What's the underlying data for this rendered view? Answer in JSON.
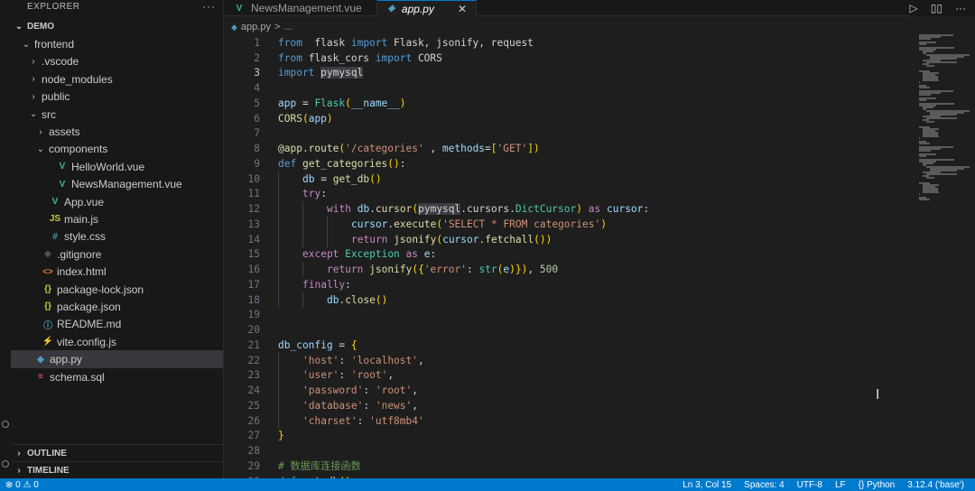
{
  "sidebar": {
    "title": "EXPLORER",
    "more": "···",
    "tree": [
      {
        "label": "DEMO",
        "depth": 0,
        "chevron": "open",
        "icon": "",
        "kind": "root"
      },
      {
        "label": "frontend",
        "depth": 1,
        "chevron": "open",
        "icon": "",
        "kind": "folder"
      },
      {
        "label": ".vscode",
        "depth": 2,
        "chevron": "closed",
        "icon": "",
        "kind": "folder"
      },
      {
        "label": "node_modules",
        "depth": 2,
        "chevron": "closed",
        "icon": "",
        "kind": "folder"
      },
      {
        "label": "public",
        "depth": 2,
        "chevron": "closed",
        "icon": "",
        "kind": "folder"
      },
      {
        "label": "src",
        "depth": 2,
        "chevron": "open",
        "icon": "",
        "kind": "folder"
      },
      {
        "label": "assets",
        "depth": 3,
        "chevron": "closed",
        "icon": "",
        "kind": "folder"
      },
      {
        "label": "components",
        "depth": 3,
        "chevron": "open",
        "icon": "",
        "kind": "folder"
      },
      {
        "label": "HelloWorld.vue",
        "depth": 4,
        "chevron": "none",
        "icon": "vue",
        "kind": "file"
      },
      {
        "label": "NewsManagement.vue",
        "depth": 4,
        "chevron": "none",
        "icon": "vue",
        "kind": "file"
      },
      {
        "label": "App.vue",
        "depth": 3,
        "chevron": "none",
        "icon": "vue",
        "kind": "file"
      },
      {
        "label": "main.js",
        "depth": 3,
        "chevron": "none",
        "icon": "js",
        "kind": "file"
      },
      {
        "label": "style.css",
        "depth": 3,
        "chevron": "none",
        "icon": "css",
        "kind": "file"
      },
      {
        "label": ".gitignore",
        "depth": 2,
        "chevron": "none",
        "icon": "git",
        "kind": "file"
      },
      {
        "label": "index.html",
        "depth": 2,
        "chevron": "none",
        "icon": "html",
        "kind": "file"
      },
      {
        "label": "package-lock.json",
        "depth": 2,
        "chevron": "none",
        "icon": "json",
        "kind": "file"
      },
      {
        "label": "package.json",
        "depth": 2,
        "chevron": "none",
        "icon": "json",
        "kind": "file"
      },
      {
        "label": "README.md",
        "depth": 2,
        "chevron": "none",
        "icon": "info",
        "kind": "file"
      },
      {
        "label": "vite.config.js",
        "depth": 2,
        "chevron": "none",
        "icon": "vite",
        "kind": "file"
      },
      {
        "label": "app.py",
        "depth": 1,
        "chevron": "none",
        "icon": "py",
        "kind": "file",
        "selected": true
      },
      {
        "label": "schema.sql",
        "depth": 1,
        "chevron": "none",
        "icon": "sql",
        "kind": "file"
      }
    ],
    "outline": "OUTLINE",
    "timeline": "TIMELINE"
  },
  "tabs": [
    {
      "label": "NewsManagement.vue",
      "icon": "vue",
      "active": false
    },
    {
      "label": "app.py",
      "icon": "py",
      "active": true,
      "close": "✕"
    }
  ],
  "tab_actions": [
    "▷",
    "▯▯",
    "···"
  ],
  "breadcrumb": [
    "app.py",
    ">",
    "..."
  ],
  "icons": {
    "vue": {
      "glyph": "V",
      "color": "#41b883"
    },
    "js": {
      "glyph": "JS",
      "color": "#cbcb41"
    },
    "css": {
      "glyph": "#",
      "color": "#519aba"
    },
    "git": {
      "glyph": "◆",
      "color": "#41535b"
    },
    "html": {
      "glyph": "<>",
      "color": "#e37933"
    },
    "json": {
      "glyph": "{}",
      "color": "#cbcb41"
    },
    "info": {
      "glyph": "ⓘ",
      "color": "#519aba"
    },
    "vite": {
      "glyph": "⚡",
      "color": "#cbcb41"
    },
    "py": {
      "glyph": "◆",
      "color": "#519aba"
    },
    "sql": {
      "glyph": "≡",
      "color": "#f55385"
    }
  },
  "editor": {
    "current_line": 3,
    "lines": [
      {
        "n": 1,
        "indent": 0,
        "tokens": [
          [
            "kw",
            "from"
          ],
          [
            "",
            "  flask "
          ],
          [
            "kw",
            "import"
          ],
          [
            "",
            " Flask, jsonify, request"
          ]
        ]
      },
      {
        "n": 2,
        "indent": 0,
        "tokens": [
          [
            "kw",
            "from"
          ],
          [
            "",
            " flask_cors "
          ],
          [
            "kw",
            "import"
          ],
          [
            "",
            " CORS"
          ]
        ]
      },
      {
        "n": 3,
        "indent": 0,
        "tokens": [
          [
            "kw",
            "import"
          ],
          [
            "",
            " "
          ],
          [
            "hl",
            "pymysql"
          ]
        ]
      },
      {
        "n": 4,
        "indent": 0,
        "tokens": []
      },
      {
        "n": 5,
        "indent": 0,
        "tokens": [
          [
            "var",
            "app"
          ],
          [
            "",
            " = "
          ],
          [
            "cls",
            "Flask"
          ],
          [
            "brk",
            "("
          ],
          [
            "var",
            "__name__"
          ],
          [
            "brk",
            ")"
          ]
        ]
      },
      {
        "n": 6,
        "indent": 0,
        "tokens": [
          [
            "fn",
            "CORS"
          ],
          [
            "brk",
            "("
          ],
          [
            "var",
            "app"
          ],
          [
            "brk",
            ")"
          ]
        ]
      },
      {
        "n": 7,
        "indent": 0,
        "tokens": []
      },
      {
        "n": 8,
        "indent": 0,
        "tokens": [
          [
            "fn",
            "@app.route"
          ],
          [
            "brk",
            "("
          ],
          [
            "str",
            "'/categories'"
          ],
          [
            "",
            " , "
          ],
          [
            "var",
            "methods"
          ],
          [
            "",
            "="
          ],
          [
            "brk",
            "["
          ],
          [
            "str",
            "'GET'"
          ],
          [
            "brk",
            "]"
          ],
          [
            "brk",
            ")"
          ]
        ]
      },
      {
        "n": 9,
        "indent": 0,
        "tokens": [
          [
            "kw",
            "def"
          ],
          [
            "",
            " "
          ],
          [
            "fn",
            "get_categories"
          ],
          [
            "brk",
            "()"
          ],
          [
            "",
            ":"
          ]
        ]
      },
      {
        "n": 10,
        "indent": 1,
        "tokens": [
          [
            "var",
            "db"
          ],
          [
            "",
            " = "
          ],
          [
            "fn",
            "get_db"
          ],
          [
            "brk",
            "()"
          ]
        ]
      },
      {
        "n": 11,
        "indent": 1,
        "tokens": [
          [
            "ctl",
            "try"
          ],
          [
            "",
            ":"
          ]
        ]
      },
      {
        "n": 12,
        "indent": 2,
        "tokens": [
          [
            "ctl",
            "with"
          ],
          [
            "",
            " "
          ],
          [
            "var",
            "db"
          ],
          [
            "",
            "."
          ],
          [
            "fn",
            "cursor"
          ],
          [
            "brk",
            "("
          ],
          [
            "hl",
            "pymysql"
          ],
          [
            "",
            ".cursors."
          ],
          [
            "cls",
            "DictCursor"
          ],
          [
            "brk",
            ")"
          ],
          [
            "",
            " "
          ],
          [
            "ctl",
            "as"
          ],
          [
            "",
            " "
          ],
          [
            "var",
            "cursor"
          ],
          [
            "",
            ":"
          ]
        ]
      },
      {
        "n": 13,
        "indent": 3,
        "tokens": [
          [
            "var",
            "cursor"
          ],
          [
            "",
            "."
          ],
          [
            "fn",
            "execute"
          ],
          [
            "brk",
            "("
          ],
          [
            "str",
            "'SELECT * FROM categories'"
          ],
          [
            "brk",
            ")"
          ]
        ]
      },
      {
        "n": 14,
        "indent": 3,
        "tokens": [
          [
            "ctl",
            "return"
          ],
          [
            "",
            " "
          ],
          [
            "fn",
            "jsonify"
          ],
          [
            "brk",
            "("
          ],
          [
            "var",
            "cursor"
          ],
          [
            "",
            "."
          ],
          [
            "fn",
            "fetchall"
          ],
          [
            "brk",
            "())"
          ]
        ]
      },
      {
        "n": 15,
        "indent": 1,
        "tokens": [
          [
            "ctl",
            "except"
          ],
          [
            "",
            " "
          ],
          [
            "cls",
            "Exception"
          ],
          [
            "",
            " "
          ],
          [
            "ctl",
            "as"
          ],
          [
            "",
            " "
          ],
          [
            "var",
            "e"
          ],
          [
            "",
            ":"
          ]
        ]
      },
      {
        "n": 16,
        "indent": 2,
        "tokens": [
          [
            "ctl",
            "return"
          ],
          [
            "",
            " "
          ],
          [
            "fn",
            "jsonify"
          ],
          [
            "brk",
            "({"
          ],
          [
            "str",
            "'error'"
          ],
          [
            "",
            ": "
          ],
          [
            "cls",
            "str"
          ],
          [
            "brk",
            "("
          ],
          [
            "var",
            "e"
          ],
          [
            "brk",
            ")})"
          ],
          [
            "",
            ", "
          ],
          [
            "num",
            "500"
          ]
        ]
      },
      {
        "n": 17,
        "indent": 1,
        "tokens": [
          [
            "ctl",
            "finally"
          ],
          [
            "",
            ":"
          ]
        ]
      },
      {
        "n": 18,
        "indent": 2,
        "tokens": [
          [
            "var",
            "db"
          ],
          [
            "",
            "."
          ],
          [
            "fn",
            "close"
          ],
          [
            "brk",
            "()"
          ]
        ]
      },
      {
        "n": 19,
        "indent": 0,
        "tokens": []
      },
      {
        "n": 20,
        "indent": 0,
        "tokens": []
      },
      {
        "n": 21,
        "indent": 0,
        "tokens": [
          [
            "var",
            "db_config"
          ],
          [
            "",
            " = "
          ],
          [
            "brk",
            "{"
          ]
        ]
      },
      {
        "n": 22,
        "indent": 1,
        "tokens": [
          [
            "str",
            "'host'"
          ],
          [
            "",
            ": "
          ],
          [
            "str",
            "'localhost'"
          ],
          [
            "",
            ","
          ]
        ]
      },
      {
        "n": 23,
        "indent": 1,
        "tokens": [
          [
            "str",
            "'user'"
          ],
          [
            "",
            ": "
          ],
          [
            "str",
            "'root'"
          ],
          [
            "",
            ","
          ]
        ]
      },
      {
        "n": 24,
        "indent": 1,
        "tokens": [
          [
            "str",
            "'password'"
          ],
          [
            "",
            ": "
          ],
          [
            "str",
            "'root'"
          ],
          [
            "",
            ","
          ]
        ]
      },
      {
        "n": 25,
        "indent": 1,
        "tokens": [
          [
            "str",
            "'database'"
          ],
          [
            "",
            ": "
          ],
          [
            "str",
            "'news'"
          ],
          [
            "",
            ","
          ]
        ]
      },
      {
        "n": 26,
        "indent": 1,
        "tokens": [
          [
            "str",
            "'charset'"
          ],
          [
            "",
            ": "
          ],
          [
            "str",
            "'utf8mb4'"
          ]
        ]
      },
      {
        "n": 27,
        "indent": 0,
        "tokens": [
          [
            "brk",
            "}"
          ]
        ]
      },
      {
        "n": 28,
        "indent": 0,
        "tokens": []
      },
      {
        "n": 29,
        "indent": 0,
        "tokens": [
          [
            "cmt",
            "# 数据库连接函数"
          ]
        ]
      },
      {
        "n": 30,
        "indent": 0,
        "tokens": [
          [
            "kw",
            "def"
          ],
          [
            "",
            " "
          ],
          [
            "fn",
            "get_db"
          ],
          [
            "brk",
            "()"
          ],
          [
            "",
            ":"
          ]
        ]
      }
    ]
  },
  "status": {
    "problems": "⊗ 0  ⚠ 0",
    "ln_col": "Ln 3, Col 15",
    "spaces": "Spaces: 4",
    "encoding": "UTF-8",
    "eol": "LF",
    "language": "{} Python",
    "interpreter": "3.12.4 ('base')"
  }
}
